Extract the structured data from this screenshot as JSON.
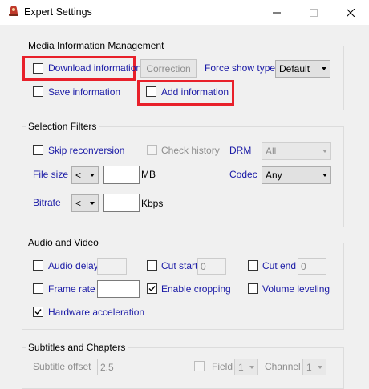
{
  "window": {
    "title": "Expert Settings"
  },
  "colors": {
    "label_blue": "#1a1aa6",
    "highlight_red": "#e8202a",
    "disabled_gray": "#8d8d8d"
  },
  "media_info": {
    "group_label": "Media Information Management",
    "download_information": "Download information",
    "correction": "Correction",
    "force_show_type": "Force show type",
    "force_show_value": "Default",
    "save_information": "Save information",
    "add_information": "Add information"
  },
  "selection_filters": {
    "group_label": "Selection Filters",
    "skip_reconversion": "Skip reconversion",
    "check_history": "Check history",
    "drm_label": "DRM",
    "drm_value": "All",
    "file_size_label": "File size",
    "file_size_op": "<",
    "file_size_value": "",
    "mb_unit": "MB",
    "codec_label": "Codec",
    "codec_value": "Any",
    "bitrate_label": "Bitrate",
    "bitrate_op": "<",
    "bitrate_value": "",
    "kbps_unit": "Kbps"
  },
  "audio_video": {
    "group_label": "Audio and Video",
    "audio_delay": "Audio delay",
    "audio_delay_value": "",
    "cut_start": "Cut start",
    "cut_start_value": "0",
    "cut_end": "Cut end",
    "cut_end_value": "0",
    "frame_rate": "Frame rate",
    "frame_rate_value": "",
    "enable_cropping": "Enable cropping",
    "enable_cropping_checked": true,
    "volume_leveling": "Volume leveling",
    "hardware_acceleration": "Hardware acceleration",
    "hardware_acceleration_checked": true
  },
  "subtitles": {
    "group_label": "Subtitles and Chapters",
    "subtitle_offset": "Subtitle offset",
    "subtitle_offset_value": "2.5",
    "field_label": "Field",
    "field_value": "1",
    "channel_label": "Channel",
    "channel_value": "1"
  }
}
